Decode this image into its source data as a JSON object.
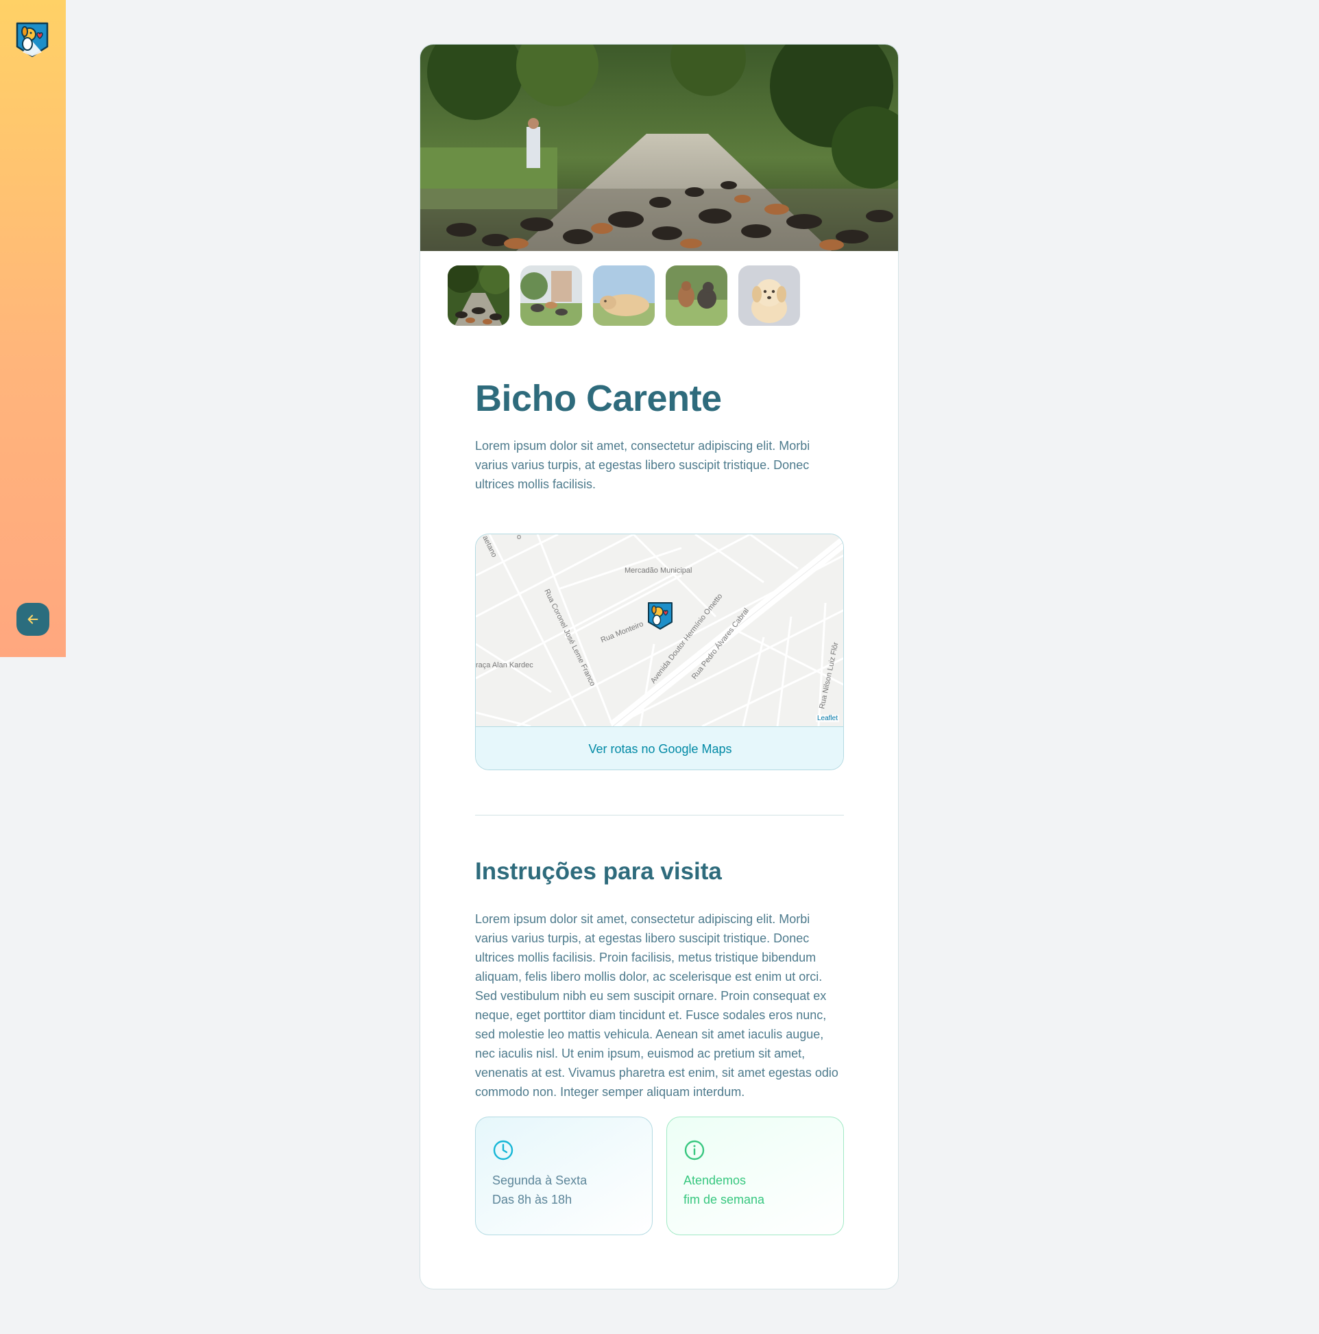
{
  "sidebar": {
    "logo_icon": "dog-heart-shield-icon",
    "back_icon": "arrow-left-icon",
    "colors": {
      "gradient_top": "#ffd166",
      "gradient_bottom": "#ffa77f",
      "back_button": "#2b6d7e"
    }
  },
  "orphanage": {
    "name": "Bicho Carente",
    "about": "Lorem ipsum dolor sit amet, consectetur adipiscing elit. Morbi varius varius turpis, at egestas libero suscipit tristique. Donec ultrices mollis facilisis.",
    "images": [
      {
        "name": "park-dogs-photo",
        "active": true
      },
      {
        "name": "garden-dogs-photo",
        "active": false
      },
      {
        "name": "sleeping-dog-photo",
        "active": false
      },
      {
        "name": "dogs-on-grass-photo",
        "active": false
      },
      {
        "name": "puppy-photo",
        "active": false
      }
    ]
  },
  "map": {
    "link_label": "Ver rotas no Google Maps",
    "attribution": "Leaflet",
    "marker_icon": "dog-heart-shield-icon",
    "street_labels": [
      "Mercadão Municipal",
      "Rua Coronel José Leme Franco",
      "Rua Monteiro",
      "Avenida Doutor Hermínio Ometto",
      "Rua Pedro Álvares Cabral",
      "raça Alan Kardec",
      "Rua Nilson Luiz Flôr",
      "aetano",
      "o"
    ]
  },
  "visit": {
    "title": "Instruções para visita",
    "instructions": "Lorem ipsum dolor sit amet, consectetur adipiscing elit. Morbi varius varius turpis, at egestas libero suscipit tristique. Donec ultrices mollis facilisis. Proin facilisis, metus tristique bibendum aliquam, felis libero mollis dolor, ac scelerisque est enim ut orci. Sed vestibulum nibh eu sem suscipit ornare. Proin consequat ex neque, eget porttitor diam tincidunt et. Fusce sodales eros nunc, sed molestie leo mattis vehicula. Aenean sit amet iaculis augue, nec iaculis nisl. Ut enim ipsum, euismod ac pretium sit amet, venenatis at est. Vivamus pharetra est enim, sit amet egestas odio commodo non. Integer semper aliquam interdum.",
    "hours": {
      "icon": "clock-icon",
      "line1": "Segunda à Sexta",
      "line2": "Das 8h às 18h"
    },
    "weekend": {
      "icon": "info-icon",
      "line1": "Atendemos",
      "line2": "fim de semana"
    }
  },
  "colors": {
    "heading": "#2e6b7c",
    "text": "#4d7a8c",
    "link": "#0089a5",
    "hours_accent": "#15b6d6",
    "weekend_accent": "#37c77f"
  }
}
